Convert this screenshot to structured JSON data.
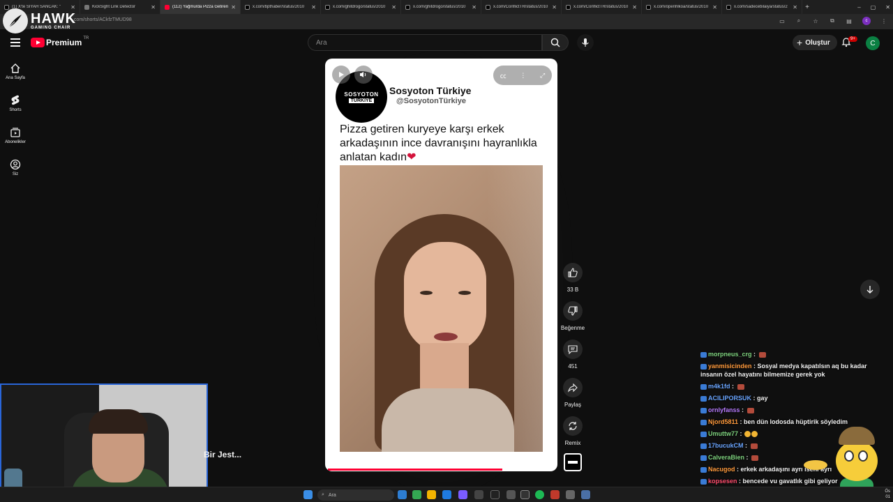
{
  "browser": {
    "tabs": [
      {
        "label": "(1) X'te SİYAH SANCAK: \"",
        "icon": "x-icon"
      },
      {
        "label": "KickSight Link Detector",
        "icon": "extension-icon"
      },
      {
        "label": "(112) Yağmurda Pizza Getiren",
        "icon": "youtube-icon",
        "active": true
      },
      {
        "label": "x.com/bpthaber/status/2010",
        "icon": "x-icon"
      },
      {
        "label": "x.com/ghitdrogo/status/2010",
        "icon": "x-icon"
      },
      {
        "label": "x.com/ghitdrogo/status/2010",
        "icon": "x-icon"
      },
      {
        "label": "x.com/ConflictTR/status/2010",
        "icon": "x-icon"
      },
      {
        "label": "x.com/ConflictTR/status/2010",
        "icon": "x-icon"
      },
      {
        "label": "x.com/openhlkoa/status/2010",
        "icon": "x-icon"
      },
      {
        "label": "x.com/sadecebilaiya/status/2",
        "icon": "x-icon"
      }
    ],
    "new_tab": "+",
    "url": ".com/shorts/ACkfzTMUD98",
    "profile_initial": "c"
  },
  "overlay_logo": {
    "main": "HAWK",
    "sub": "GAMING CHAIR"
  },
  "masthead": {
    "logo_text": "Premium",
    "region": "TR",
    "search_placeholder": "Ara",
    "create_label": "Oluştur",
    "notif_badge": "9+",
    "avatar_initial": "C"
  },
  "guide": {
    "items": [
      {
        "label": "Ana Sayfa",
        "icon": "home-icon"
      },
      {
        "label": "Shorts",
        "icon": "shorts-icon"
      },
      {
        "label": "Abonelikler",
        "icon": "subscriptions-icon"
      },
      {
        "label": "Siz",
        "icon": "you-icon"
      }
    ]
  },
  "short": {
    "channel_logo_line1": "SOSYOTON",
    "channel_logo_line2": "TÜRKİYE",
    "channel_name": "Sosyoton Türkiye",
    "channel_handle": "@SosyotonTürkiye",
    "caption": "Pizza getiren kuryeye karşı erkek arkadaşının ince davranışını hayranlıkla anlatan kadın",
    "caption_emoji": "❤",
    "progress": 0.77
  },
  "actions": {
    "like_count": "33 B",
    "dislike_label": "Beğenme",
    "comment_count": "451",
    "share_label": "Paylaş",
    "remix_label": "Remix"
  },
  "stream": {
    "partial_title": "Bir Jest..."
  },
  "chat": [
    {
      "user": "morpneus_crg",
      "user_color": "#7fd37f",
      "message": "",
      "emote": true
    },
    {
      "user": "yanmisicinden",
      "user_color": "#ff9a3c",
      "message": "Sosyal medya kapatılsın aq bu kadar insanın özel hayatını bilmemize gerek yok",
      "emote": false
    },
    {
      "user": "m4k1fd",
      "user_color": "#6aa5ff",
      "message": "",
      "emote": true
    },
    {
      "user": "ACILIPORSUK",
      "user_color": "#6aa5ff",
      "message": "gay",
      "emote": false
    },
    {
      "user": "ornlyfanss",
      "user_color": "#b77cff",
      "message": "",
      "emote": true
    },
    {
      "user": "Njord5811",
      "user_color": "#ff9a3c",
      "message": "ben dün lodosda hüptirik söyledim",
      "emote": false
    },
    {
      "user": "Umuttw77",
      "user_color": "#7fd37f",
      "message": "",
      "emote": false,
      "emoji": true
    },
    {
      "user": "17bucukCM",
      "user_color": "#6aa5ff",
      "message": "",
      "emote": true
    },
    {
      "user": "CalveraBien",
      "user_color": "#7fd37f",
      "message": "",
      "emote": true
    },
    {
      "user": "Nacugod",
      "user_color": "#ff9a3c",
      "message": "erkek arkadaşını ayrı iseni ayrı",
      "emote": false
    },
    {
      "user": "kopsesen",
      "user_color": "#ff4d6d",
      "message": "bencede vu gavatlık gibi geliyor",
      "emote": false
    }
  ],
  "taskbar": {
    "search_placeholder": "Ara",
    "clock_line1": "Ös",
    "clock_line2": "01"
  },
  "colors": {
    "youtube_red": "#ff0033",
    "background": "#0f0f0f",
    "webcam_border": "#2a66d9"
  }
}
